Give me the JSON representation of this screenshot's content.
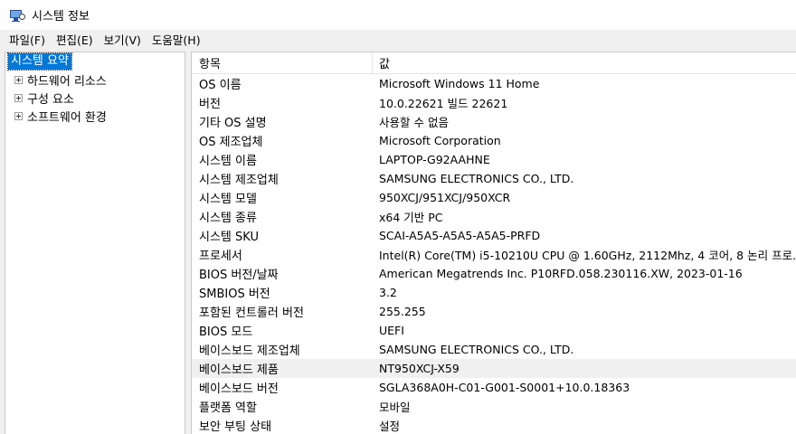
{
  "window": {
    "title": "시스템 정보",
    "icon": "system-info-icon"
  },
  "menu": [
    {
      "label": "파일(F)"
    },
    {
      "label": "편집(E)"
    },
    {
      "label": "보기(V)"
    },
    {
      "label": "도움말(H)"
    }
  ],
  "tree": {
    "root": "시스템 요약",
    "children": [
      {
        "label": "하드웨어 리소스"
      },
      {
        "label": "구성 요소"
      },
      {
        "label": "소프트웨어 환경"
      }
    ]
  },
  "table": {
    "headers": {
      "item": "항목",
      "value": "값"
    },
    "selected_row_index": 15,
    "rows": [
      {
        "item": "OS 이름",
        "value": "Microsoft Windows 11 Home"
      },
      {
        "item": "버전",
        "value": "10.0.22621 빌드 22621"
      },
      {
        "item": "기타 OS 설명",
        "value": "사용할 수 없음"
      },
      {
        "item": "OS 제조업체",
        "value": "Microsoft Corporation"
      },
      {
        "item": "시스템 이름",
        "value": "LAPTOP-G92AAHNE"
      },
      {
        "item": "시스템 제조업체",
        "value": "SAMSUNG ELECTRONICS CO., LTD."
      },
      {
        "item": "시스템 모델",
        "value": "950XCJ/951XCJ/950XCR"
      },
      {
        "item": "시스템 종류",
        "value": "x64 기반 PC"
      },
      {
        "item": "시스템 SKU",
        "value": "SCAI-A5A5-A5A5-A5A5-PRFD"
      },
      {
        "item": "프로세서",
        "value": "Intel(R) Core(TM) i5-10210U CPU @ 1.60GHz, 2112Mhz, 4 코어, 8 논리 프로..."
      },
      {
        "item": "BIOS 버전/날짜",
        "value": "American Megatrends Inc. P10RFD.058.230116.XW, 2023-01-16"
      },
      {
        "item": "SMBIOS 버전",
        "value": "3.2"
      },
      {
        "item": "포함된 컨트롤러 버전",
        "value": "255.255"
      },
      {
        "item": "BIOS 모드",
        "value": "UEFI"
      },
      {
        "item": "베이스보드 제조업체",
        "value": "SAMSUNG ELECTRONICS CO., LTD."
      },
      {
        "item": "베이스보드 제품",
        "value": "NT950XCJ-X59"
      },
      {
        "item": "베이스보드 버전",
        "value": "SGLA368A0H-C01-G001-S0001+10.0.18363"
      },
      {
        "item": "플랫폼 역할",
        "value": "모바일"
      },
      {
        "item": "보안 부팅 상태",
        "value": "설정"
      }
    ]
  }
}
